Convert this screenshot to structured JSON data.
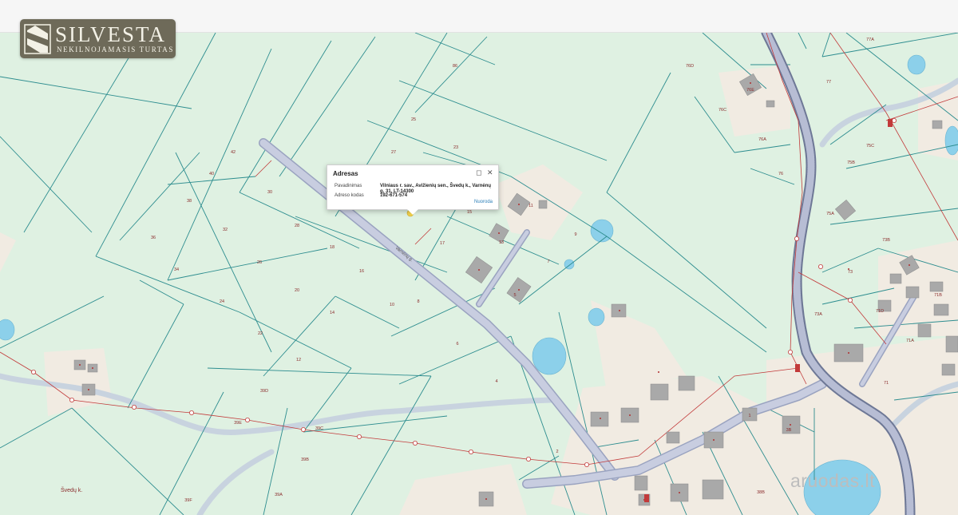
{
  "logo": {
    "name": "SILVESTA",
    "tagline": "NEKILNOJAMASIS TURTAS"
  },
  "popup": {
    "title": "Adresas",
    "rows": [
      {
        "label": "Pavadinimas",
        "value": "Vilniaus r. sav., Avižienių sen., Švedų k., Varnėnų g. 31, LT-14300"
      },
      {
        "label": "Adreso kodas",
        "value": "192-671-574"
      }
    ],
    "link": "Nuoroda"
  },
  "map": {
    "street_label": "Varnėnų g.",
    "village_label": "Švedų k.",
    "parcel_numbers": [
      "86",
      "77A",
      "76D",
      "76E",
      "76C",
      "77",
      "76A",
      "75C",
      "76",
      "75B",
      "75A",
      "73B",
      "73",
      "73A",
      "71D",
      "71B",
      "71A",
      "71",
      "25",
      "27",
      "23",
      "42",
      "40",
      "30",
      "38",
      "36",
      "32",
      "34",
      "28",
      "26",
      "24",
      "22",
      "18",
      "20",
      "16",
      "14",
      "12",
      "10",
      "8",
      "6",
      "4",
      "2",
      "17",
      "15",
      "11",
      "13",
      "9",
      "7",
      "5",
      "39D",
      "39C",
      "39B",
      "39A",
      "39F",
      "39E",
      "3B",
      "38B",
      "1"
    ],
    "colors": {
      "land": "#dff1e2",
      "built": "#f1ebe2",
      "parcel_line": "#2d8d8f",
      "road": "#c3c8dc",
      "rail": "#7e86a6",
      "water": "#8cd0ea",
      "power_line": "#c23a3a",
      "building": "#a8a8a8"
    }
  },
  "watermark": "aruodas.lt"
}
